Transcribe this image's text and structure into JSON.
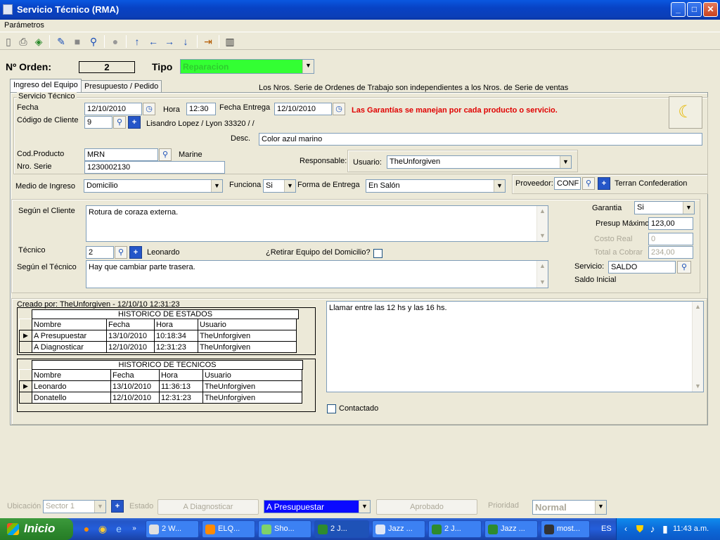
{
  "window": {
    "title": "Servicio Técnico (RMA)",
    "minimize": "_",
    "maximize": "□",
    "close": "✕"
  },
  "menu": {
    "parametros": "Parámetros"
  },
  "toolbar_icons": [
    "new-icon",
    "print-icon",
    "refresh-icon",
    "clear-icon",
    "stop-icon",
    "search-icon",
    "record-icon",
    "arrow-up-icon",
    "arrow-left-icon",
    "arrow-right-icon",
    "arrow-down-icon",
    "exit-icon",
    "columns-icon"
  ],
  "header": {
    "orden_label": "Nº Orden:",
    "orden_value": "2",
    "tipo_label": "Tipo",
    "tipo_value": "Reparacion",
    "tipo_color": "#33ff33"
  },
  "tabs": [
    {
      "label": "Ingreso del Equipo"
    },
    {
      "label": "Presupuesto / Pedido"
    }
  ],
  "notice": "Los Nros. Serie de Ordenes de Trabajo son independientes a los Nros. de Serie de ventas",
  "servicio": {
    "group_title": "Servicio Técnico",
    "fecha_label": "Fecha",
    "fecha_value": "12/10/2010",
    "hora_label": "Hora",
    "hora_value": "12:30",
    "entrega_label": "Fecha Entrega",
    "entrega_value": "12/10/2010",
    "garantias_msg": "Las Garantías se manejan por cada producto o servicio.",
    "garantias_color": "#e00000",
    "cliente_label": "Código de Cliente",
    "cliente_value": "9",
    "cliente_name": "Lisandro Lopez / Lyon 33320 /  /",
    "desc_label": "Desc.",
    "desc_value": "Color azul marino",
    "producto_label": "Cod.Producto",
    "producto_value": "MRN",
    "producto_name": "Marine",
    "serie_label": "Nro. Serie",
    "serie_value": "1230002130",
    "responsable_label": "Responsable:",
    "usuario_label": "Usuario:",
    "usuario_value": "TheUnforgiven",
    "medio_label": "Medio de Ingreso",
    "medio_value": "Domicilio",
    "funciona_label": "Funciona",
    "funciona_value": "Si",
    "forma_label": "Forma de Entrega",
    "forma_value": "En Salón",
    "proveedor_label": "Proveedor:",
    "proveedor_value": "CONF",
    "proveedor_name": "Terran Confederation"
  },
  "detalle": {
    "cliente_label": "Según el Cliente",
    "cliente_text": "Rotura de coraza externa.",
    "tecnico_label": "Técnico",
    "tecnico_value": "2",
    "tecnico_name": "Leonardo",
    "retirar_label": "¿Retirar Equipo del Domicilio?",
    "segun_tecnico_label": "Según el Técnico",
    "segun_tecnico_text": "Hay que cambiar parte trasera.",
    "garantia_label": "Garantia",
    "garantia_value": "Si",
    "presup_label": "Presup Máximo",
    "presup_value": "123,00",
    "costo_label": "Costo Real",
    "costo_value": "0",
    "total_label": "Total a Cobrar",
    "total_value": "234,00",
    "servicio_label": "Servicio:",
    "servicio_value": "SALDO",
    "saldo_label": "Saldo Inicial"
  },
  "historial": {
    "creado": "Creado por: TheUnforgiven - 12/10/10 12:31:23",
    "estados_title": "HISTORICO DE ESTADOS",
    "estados_cols": [
      "Nombre",
      "Fecha",
      "Hora",
      "Usuario"
    ],
    "estados_rows": [
      [
        "A Presupuestar",
        "13/10/2010",
        "10:18:34",
        "TheUnforgiven"
      ],
      [
        "A Diagnosticar",
        "12/10/2010",
        "12:31:23",
        "TheUnforgiven"
      ]
    ],
    "tecnicos_title": "HISTORICO DE TECNICOS",
    "tecnicos_cols": [
      "Nombre",
      "Fecha",
      "Hora",
      "Usuario"
    ],
    "tecnicos_rows": [
      [
        "Leonardo",
        "13/10/2010",
        "11:36:13",
        "TheUnforgiven"
      ],
      [
        "Donatello",
        "12/10/2010",
        "12:31:23",
        "TheUnforgiven"
      ]
    ],
    "nota": "Llamar entre las 12 hs y las 16 hs.",
    "contactado_label": "Contactado"
  },
  "statusbar": {
    "ubicacion_label": "Ubicación",
    "ubicacion_value": "Sector 1",
    "estado_label": "Estado",
    "diagnosticar_btn": "A Diagnosticar",
    "estado_value": "A Presupuestar",
    "estado_color": "#0a0aff",
    "aprobado_btn": "Aprobado",
    "prioridad_label": "Prioridad",
    "prioridad_value": "Normal"
  },
  "taskbar": {
    "start": "Inicio",
    "tasks": [
      "2 W...",
      "ELQ...",
      "Sho...",
      "2 J...",
      "Jazz ...",
      "2 J...",
      "Jazz ...",
      "most..."
    ],
    "lang": "ES",
    "clock": "11:43 a.m."
  }
}
